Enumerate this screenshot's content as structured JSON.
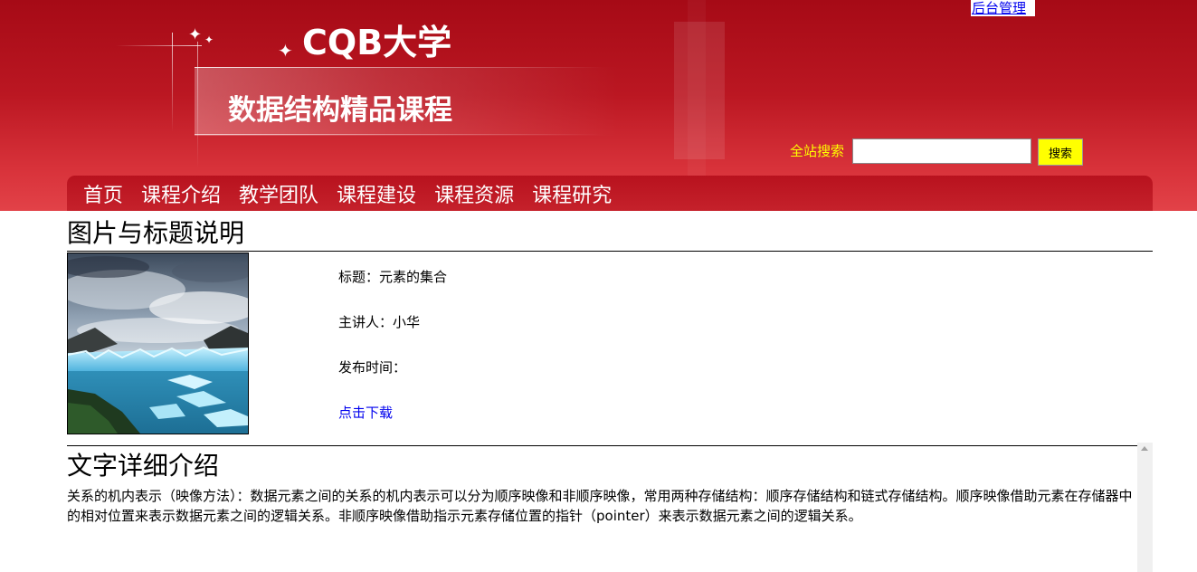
{
  "header": {
    "school_name": "CQB大学",
    "course_name": "数据结构精品课程",
    "admin_link": "后台管理",
    "search": {
      "label": "全站搜索",
      "value": "",
      "placeholder": "",
      "button_label": "搜索"
    },
    "colors": {
      "banner_red": "#c01a24",
      "search_label": "#ffff00",
      "search_button": "#ffff00"
    }
  },
  "nav": {
    "items": [
      {
        "label": "首页"
      },
      {
        "label": "课程介绍"
      },
      {
        "label": "教学团队"
      },
      {
        "label": "课程建设"
      },
      {
        "label": "课程资源"
      },
      {
        "label": "课程研究"
      }
    ]
  },
  "image_section": {
    "heading": "图片与标题说明",
    "photo_icon": "glacier-landscape-photo",
    "title_line": "标题：元素的集合",
    "speaker_line": "主讲人：小华",
    "publish_line": "发布时间：",
    "download_label": "点击下载"
  },
  "text_section": {
    "heading": "文字详细介绍",
    "body": "关系的机内表示（映像方法）：数据元素之间的关系的机内表示可以分为顺序映像和非顺序映像，常用两种存储结构：顺序存储结构和链式存储结构。顺序映像借助元素在存储器中的相对位置来表示数据元素之间的逻辑关系。非顺序映像借助指示元素存储位置的指针（pointer）来表示数据元素之间的逻辑关系。"
  }
}
